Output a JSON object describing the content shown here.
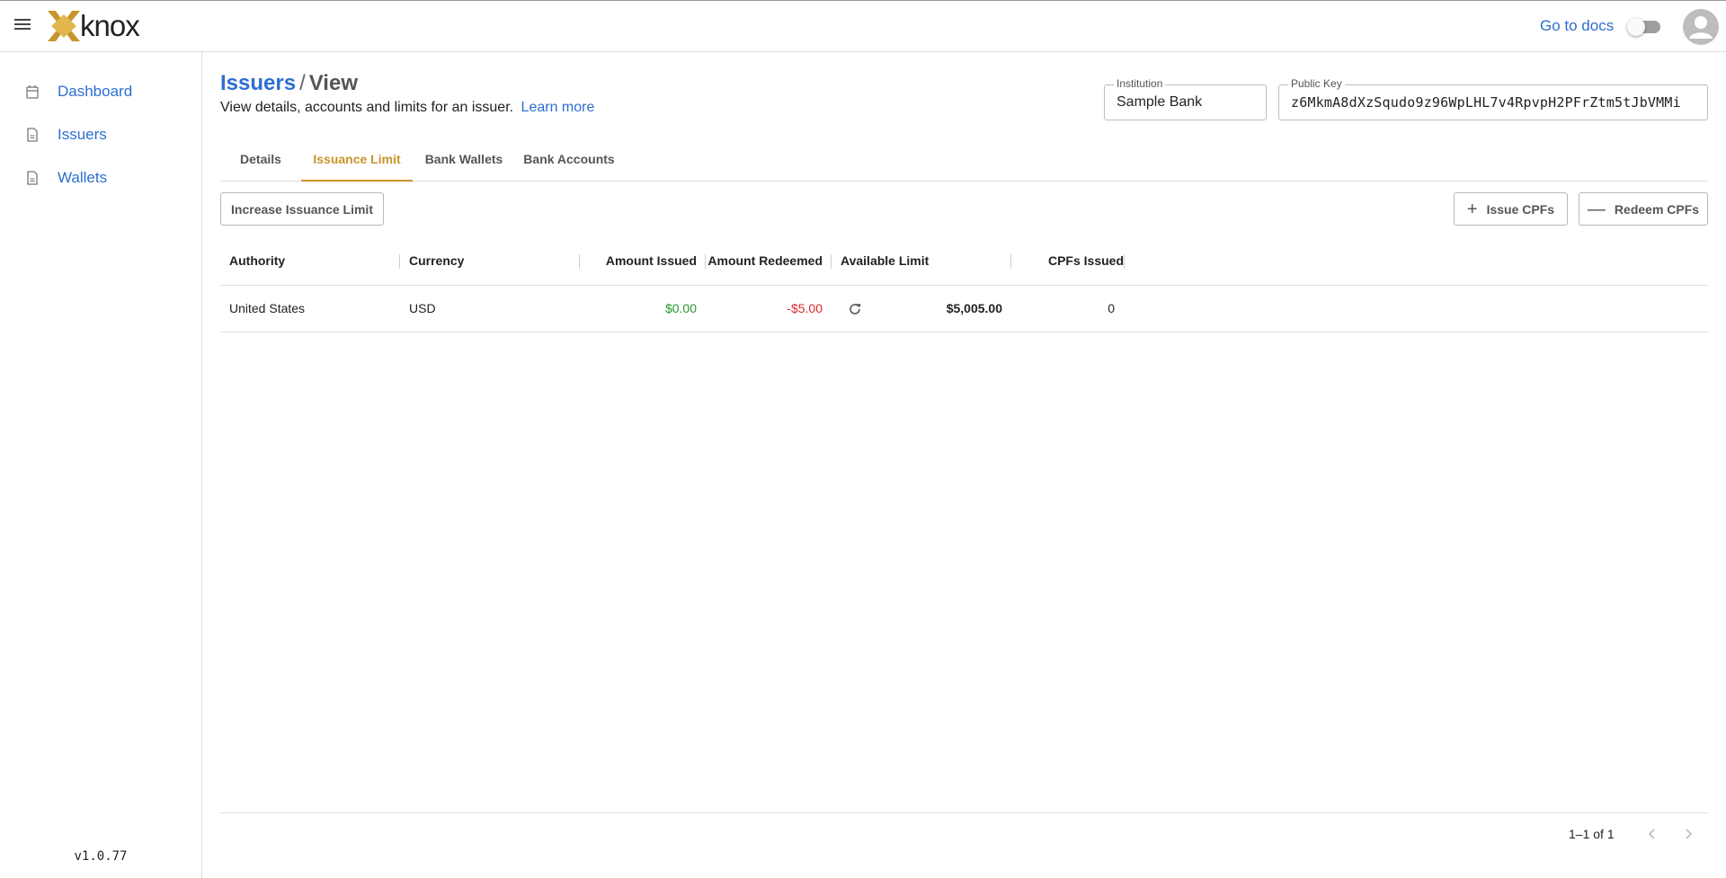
{
  "header": {
    "brand": "knox",
    "docs_label": "Go to docs",
    "menu_icon": "menu-icon",
    "avatar_icon": "account-circle-icon",
    "brand_color": "#c9952b",
    "link_color": "#2d6fd1"
  },
  "sidebar": {
    "items": [
      {
        "label": "Dashboard",
        "icon": "calendar-icon"
      },
      {
        "label": "Issuers",
        "icon": "document-icon"
      },
      {
        "label": "Wallets",
        "icon": "document-icon"
      }
    ],
    "version": "v1.0.77"
  },
  "page": {
    "breadcrumb_parent": "Issuers",
    "breadcrumb_sep": "/",
    "breadcrumb_current": "View",
    "subtitle": "View details, accounts and limits for an issuer.",
    "learn_more": "Learn more"
  },
  "fields": {
    "institution_label": "Institution",
    "institution_value": "Sample Bank",
    "public_key_label": "Public Key",
    "public_key_value": "z6MkmA8dXzSqudo9z96WpLHL7v4RpvpH2PFrZtm5tJbVMMi"
  },
  "tabs": [
    {
      "label": "Details",
      "active": false
    },
    {
      "label": "Issuance Limit",
      "active": true
    },
    {
      "label": "Bank Wallets",
      "active": false
    },
    {
      "label": "Bank Accounts",
      "active": false
    }
  ],
  "actions": {
    "increase_limit": "Increase Issuance Limit",
    "issue": "Issue CPFs",
    "redeem": "Redeem CPFs"
  },
  "table": {
    "columns": [
      "Authority",
      "Currency",
      "Amount Issued",
      "Amount Redeemed",
      "Available Limit",
      "CPFs Issued"
    ],
    "rows": [
      {
        "authority": "United States",
        "currency": "USD",
        "amount_issued": "$0.00",
        "amount_redeemed": "-$5.00",
        "available_limit": "$5,005.00",
        "cpfs_issued": "0"
      }
    ]
  },
  "pagination": {
    "range": "1–1 of 1"
  }
}
